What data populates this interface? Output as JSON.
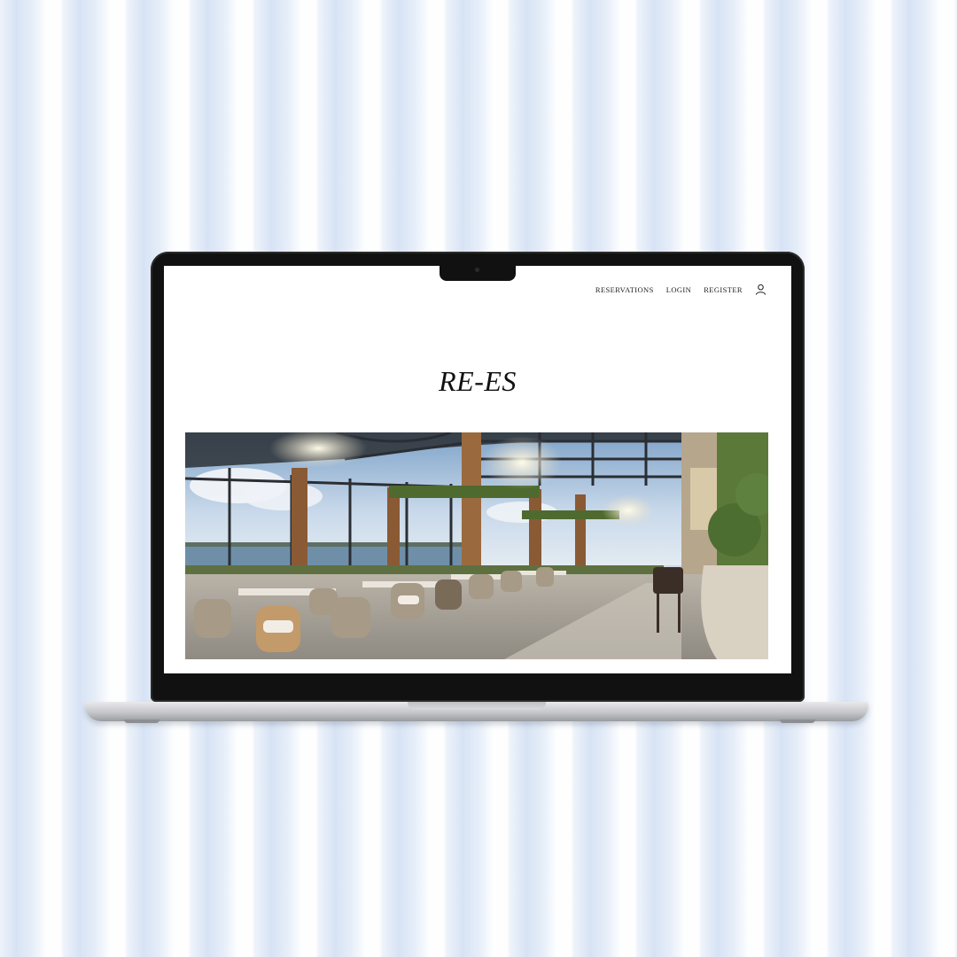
{
  "nav": {
    "items": [
      {
        "label": "RESERVATIONS"
      },
      {
        "label": "LOGIN"
      },
      {
        "label": "REGISTER"
      }
    ],
    "account_icon": "user-icon"
  },
  "site": {
    "title": "RE-ES"
  },
  "hero": {
    "image": "restaurant-interior-photo"
  },
  "colors": {
    "background": "#eef3fa",
    "stripe": "#c4d6f0",
    "bezel": "#111111",
    "screen": "#ffffff",
    "text": "#1c1c1c"
  }
}
